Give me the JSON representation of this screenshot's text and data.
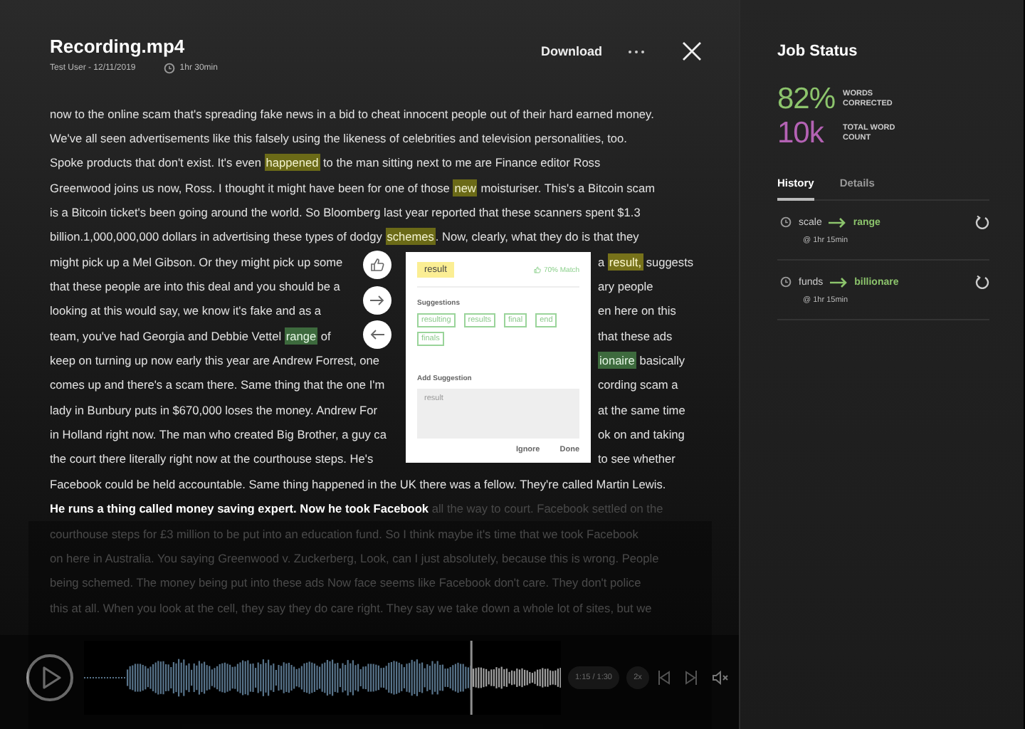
{
  "header": {
    "title": "Recording.mp4",
    "meta": "Test User - 12/11/2019",
    "duration": "1hr 30min",
    "download": "Download"
  },
  "transcript": {
    "lines": [
      {
        "left": [
          {
            "kind": "plain",
            "text": "now to the online scam that's spreading fake news in a bid to cheat innocent people out of their hard earned money."
          }
        ]
      },
      {
        "left": [
          {
            "kind": "plain",
            "text": "We've all seen advertisements like this falsely using the likeness of celebrities and television personalities, too."
          }
        ]
      },
      {
        "left": [
          {
            "kind": "plain",
            "text": "Spoke products that don't exist. It's even "
          },
          {
            "kind": "flagged",
            "text": "happened"
          },
          {
            "kind": "plain",
            "text": " to the man sitting next to me are Finance editor Ross"
          }
        ]
      },
      {
        "left": [
          {
            "kind": "plain",
            "text": "Greenwood joins us now, Ross. I thought it might have been for one of those "
          },
          {
            "kind": "flagged",
            "text": "new"
          },
          {
            "kind": "plain",
            "text": " moisturiser. This's a Bitcoin scam"
          }
        ]
      },
      {
        "left": [
          {
            "kind": "plain",
            "text": "is a Bitcoin ticket's been going around the world. So Bloomberg last year reported that these scanners spent $1.3"
          }
        ]
      },
      {
        "left": [
          {
            "kind": "plain",
            "text": "billion.1,000,000,000 dollars in advertising these types of dodgy "
          },
          {
            "kind": "flagged",
            "text": "schemes"
          },
          {
            "kind": "plain",
            "text": ". Now, clearly, what they do is that they"
          }
        ]
      },
      {
        "left": [
          {
            "kind": "plain",
            "text": "might pick up a Mel Gibson. Or they might pick up some"
          }
        ],
        "right": [
          {
            "kind": "plain",
            "text": "a "
          },
          {
            "kind": "active",
            "text": "result,"
          },
          {
            "kind": "plain",
            "text": " suggests"
          }
        ]
      },
      {
        "left": [
          {
            "kind": "plain",
            "text": "that these people are into this deal and you should be a"
          }
        ],
        "right": [
          {
            "kind": "plain",
            "text": "ary people"
          }
        ]
      },
      {
        "left": [
          {
            "kind": "plain",
            "text": "looking at this would say, we know it's fake and as a"
          }
        ],
        "right": [
          {
            "kind": "plain",
            "text": "en here on this"
          }
        ]
      },
      {
        "left": [
          {
            "kind": "plain",
            "text": "team, you've had Georgia and Debbie Vettel "
          },
          {
            "kind": "accepted",
            "text": "range"
          },
          {
            "kind": "plain",
            "text": " of"
          }
        ],
        "right": [
          {
            "kind": "plain",
            "text": "that these ads"
          }
        ]
      },
      {
        "left": [
          {
            "kind": "plain",
            "text": "keep on turning up now early this year are Andrew Forrest, one"
          }
        ],
        "right": [
          {
            "kind": "accepted",
            "text": "ionaire"
          },
          {
            "kind": "plain",
            "text": " basically"
          }
        ]
      },
      {
        "left": [
          {
            "kind": "plain",
            "text": "comes up and there's a scam there. Same thing that the one I'm"
          }
        ],
        "right": [
          {
            "kind": "plain",
            "text": "cording scam a"
          }
        ]
      },
      {
        "left": [
          {
            "kind": "plain",
            "text": "lady in Bunbury puts in $670,000 loses the money. Andrew For"
          }
        ],
        "right": [
          {
            "kind": "plain",
            "text": "at the same time"
          }
        ]
      },
      {
        "left": [
          {
            "kind": "plain",
            "text": "in Holland right now. The man who created Big Brother, a guy ca"
          }
        ],
        "right": [
          {
            "kind": "plain",
            "text": "ok on and taking"
          }
        ]
      },
      {
        "left": [
          {
            "kind": "plain",
            "text": "the court there literally right now at the courthouse steps. He's"
          }
        ],
        "right": [
          {
            "kind": "plain",
            "text": "to see whether"
          }
        ]
      },
      {
        "left": [
          {
            "kind": "plain",
            "text": "Facebook could be held accountable. Same thing happened in the UK there was a fellow. They're called Martin Lewis."
          }
        ]
      },
      {
        "left": [
          {
            "kind": "current",
            "text": "He runs a thing called money saving expert. Now he took Facebook"
          },
          {
            "kind": "dim",
            "text": " all the way to court. Facebook settled on the"
          }
        ]
      },
      {
        "left": [
          {
            "kind": "dim",
            "text": "courthouse steps for £3 million to be put into an education fund. So I think maybe it's time that we took Facebook"
          }
        ]
      },
      {
        "left": [
          {
            "kind": "dim",
            "text": "on here in Australia. You saying Greenwood v. Zuckerberg, Look, can I just absolutely, because this is wrong. People"
          }
        ]
      },
      {
        "left": [
          {
            "kind": "dim",
            "text": "being schemed. The money being put into these ads Now face seems like Facebook don't care. They don't police"
          }
        ]
      },
      {
        "left": [
          {
            "kind": "dim",
            "text": "this at all. When you look at the cell, they say they do care right. They say we take down a whole lot of sites, but we"
          }
        ]
      }
    ]
  },
  "popover": {
    "word": "result",
    "match": "70% Match",
    "suggestions_label": "Suggestions",
    "suggestions": [
      "resulting",
      "results",
      "final",
      "end",
      "finals"
    ],
    "add_label": "Add Suggestion",
    "placeholder": "result",
    "buttons": [
      "Ignore",
      "Done"
    ]
  },
  "player": {
    "level": 0.81,
    "time": "1:15 / 1:30",
    "speed": "2x"
  },
  "job_status": {
    "title": "Job Status",
    "stats": [
      {
        "value": "82%",
        "label": "WORDS CORRECTED",
        "color": "#8cc46c"
      },
      {
        "value": "10k",
        "label": "TOTAL WORD COUNT",
        "color": "#b462b4"
      }
    ],
    "tabs": [
      {
        "label": "History",
        "selected": true
      },
      {
        "label": "Details",
        "selected": false
      }
    ],
    "history": [
      {
        "from": "scale",
        "to": "range",
        "time": "@ 1hr 15min"
      },
      {
        "from": "funds",
        "to": "billionare",
        "time": "@ 1hr 15min"
      }
    ]
  }
}
